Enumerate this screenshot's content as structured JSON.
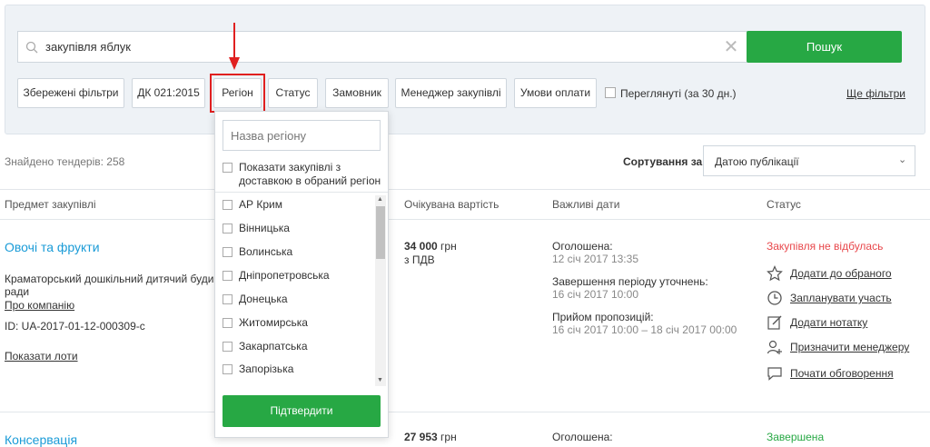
{
  "search": {
    "value": "закупівля яблук",
    "button_label": "Пошук",
    "clear_icon": "close-icon"
  },
  "filters": {
    "saved": "Збережені фільтри",
    "dk": "ДК 021:2015",
    "region": "Регіон",
    "status": "Статус",
    "customer": "Замовник",
    "manager": "Менеджер закупівлі",
    "payment": "Умови оплати",
    "viewed": "Переглянуті (за 30 дн.)",
    "more": "Ще фільтри"
  },
  "results": {
    "found": "Знайдено тендерів: 258",
    "sort_label": "Сортування за",
    "sort_value": "Датою публікації"
  },
  "columns": {
    "subject": "Предмет закупівлі",
    "value": "Очікувана вартість",
    "dates": "Важливі дати",
    "status": "Статус"
  },
  "tenders": [
    {
      "title": "Овочі та фрукти",
      "org_line1": "Краматорський дошкільний дитячий будинок",
      "org_line2": "ради",
      "about": "Про компанію",
      "id": "ID: UA-2017-01-12-000309-c",
      "show_lots": "Показати лоти",
      "amount": "34 000",
      "currency": "грн",
      "vat": "з ПДВ",
      "announced_label": "Оголошена:",
      "announced_date": "12 січ 2017 13:35",
      "clarify_label": "Завершення періоду уточнень:",
      "clarify_date": "16 січ 2017 10:00",
      "offers_label": "Прийом пропозицій:",
      "offers_date": "16 січ 2017 10:00 – 18 січ 2017 00:00",
      "status": "Закупівля не відбулась",
      "actions": {
        "favorite": "Додати до обраного",
        "plan": "Запланувати участь",
        "note": "Додати нотатку",
        "assign": "Призначити менеджеру",
        "discuss": "Почати обговорення"
      }
    },
    {
      "title": "Консервація",
      "amount": "27 953",
      "currency": "грн",
      "announced_label": "Оголошена:",
      "status": "Завершена"
    }
  ],
  "region_dropdown": {
    "placeholder": "Назва регіону",
    "delivery_label": "Показати закупівлі з доставкою в обраний регіон",
    "regions": [
      "АР Крим",
      "Вінницька",
      "Волинська",
      "Дніпропетровська",
      "Донецька",
      "Житомирська",
      "Закарпатська",
      "Запорізька"
    ],
    "confirm": "Підтвердити"
  },
  "colors": {
    "accent_green": "#27a844",
    "link_blue": "#1a9bd7",
    "fail_red": "#e8474b",
    "highlight_red": "#e02020"
  }
}
